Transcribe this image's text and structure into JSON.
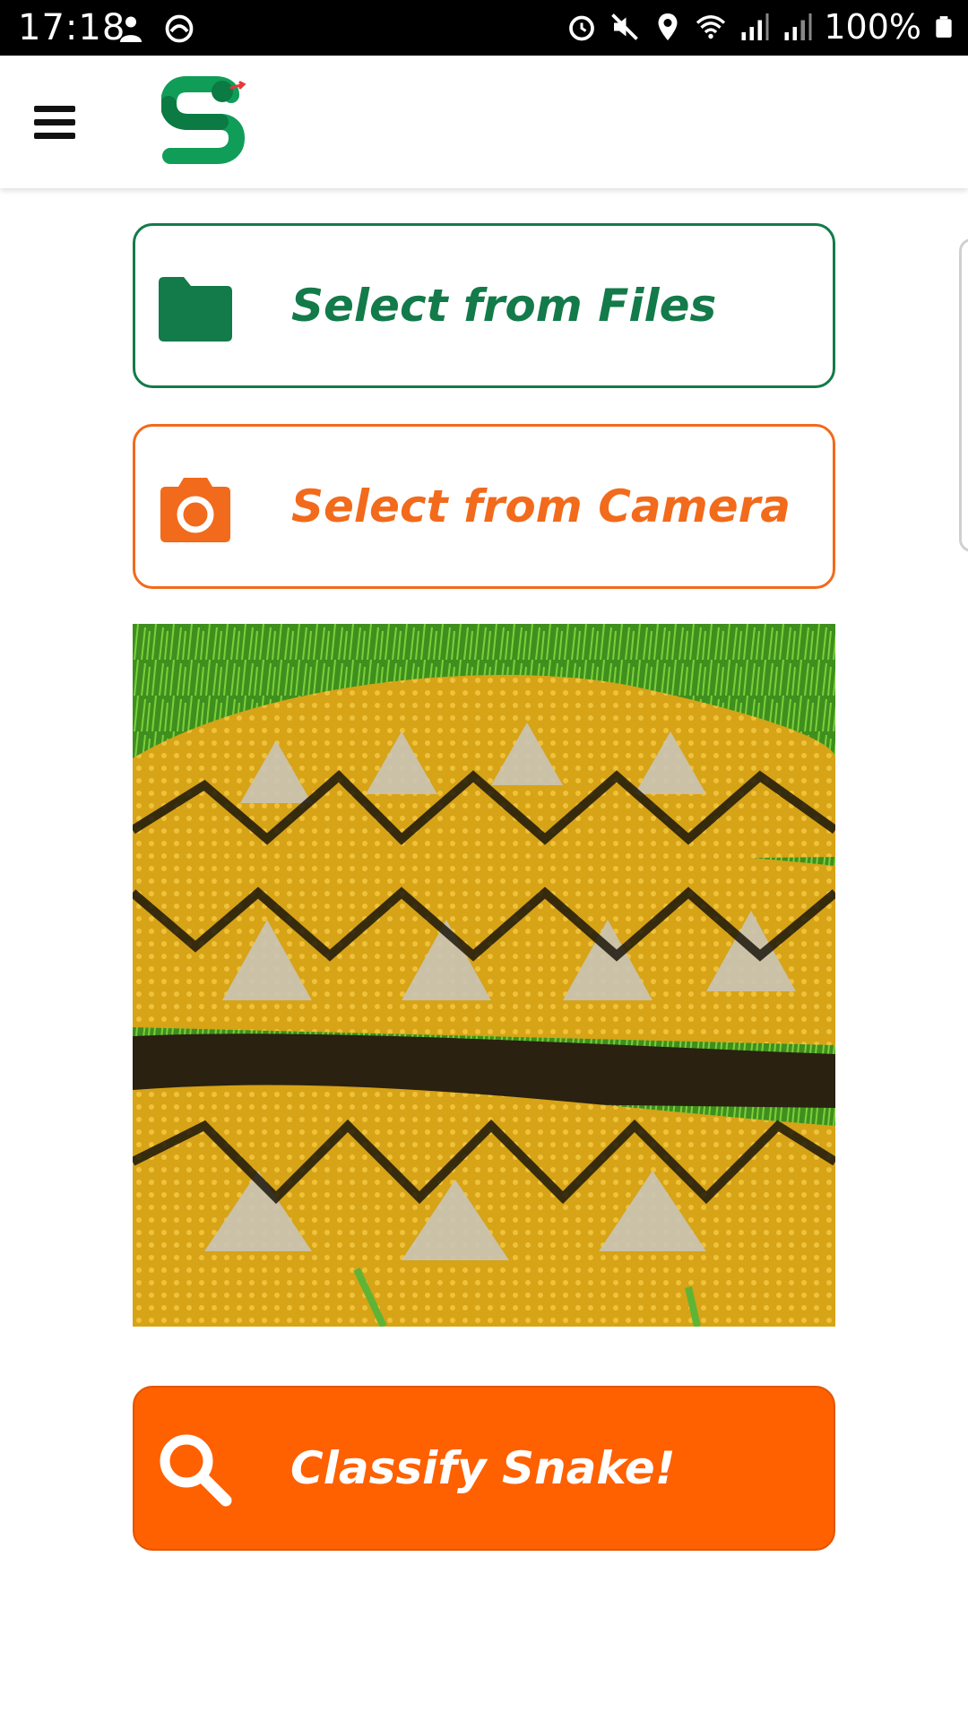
{
  "status_bar": {
    "time": "17:18",
    "battery": "100%",
    "left_icons": [
      "person-notification-icon",
      "circle-app-icon"
    ],
    "right_icons": [
      "alarm-icon",
      "mute-icon",
      "location-icon",
      "wifi-icon",
      "signal-icon",
      "signal-icon",
      "battery-icon"
    ]
  },
  "app_bar": {
    "menu_icon": "hamburger-menu-icon",
    "logo_icon": "snake-s-logo-icon"
  },
  "actions": {
    "files_label": "Select from Files",
    "files_icon": "folder-icon",
    "camera_label": "Select from Camera",
    "camera_icon": "camera-icon"
  },
  "classify": {
    "label": "Classify Snake!",
    "icon": "search-icon"
  },
  "colors": {
    "brand_green": "#137a4a",
    "accent_orange": "#ff6000",
    "camera_orange": "#f26a1b"
  }
}
